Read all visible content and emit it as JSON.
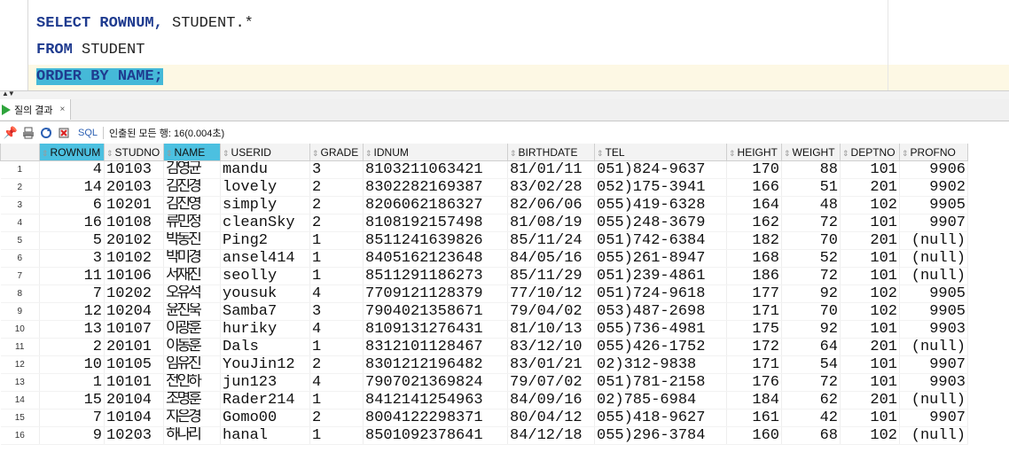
{
  "editor": {
    "line1": {
      "kw": "SELECT ROWNUM,",
      "rest": " STUDENT.*"
    },
    "line2": {
      "kw": "FROM",
      "rest": " STUDENT"
    },
    "line3": {
      "text": "ORDER BY NAME;"
    }
  },
  "results_tab": {
    "label": "질의 결과",
    "close": "×"
  },
  "toolbar": {
    "sql_label": "SQL",
    "status": "인출된 모든 행: 16(0.004초)"
  },
  "colors": {
    "selection": "#45b9d8",
    "keyword": "#1f3b8f",
    "tab_icon": "#2fa43c"
  },
  "grid": {
    "columns": [
      "ROWNUM",
      "STUDNO",
      "NAME",
      "USERID",
      "GRADE",
      "IDNUM",
      "BIRTHDATE",
      "TEL",
      "HEIGHT",
      "WEIGHT",
      "DEPTNO",
      "PROFNO"
    ],
    "rows": [
      [
        "1",
        "4",
        "10103",
        "김영균",
        "mandu",
        "3",
        "8103211063421",
        "81/01/11",
        "051)824-9637",
        "170",
        "88",
        "101",
        "9906"
      ],
      [
        "2",
        "14",
        "20103",
        "김진경",
        "lovely",
        "2",
        "8302282169387",
        "83/02/28",
        "052)175-3941",
        "166",
        "51",
        "201",
        "9902"
      ],
      [
        "3",
        "6",
        "10201",
        "김진영",
        "simply",
        "2",
        "8206062186327",
        "82/06/06",
        "055)419-6328",
        "164",
        "48",
        "102",
        "9905"
      ],
      [
        "4",
        "16",
        "10108",
        "류민정",
        "cleanSky",
        "2",
        "8108192157498",
        "81/08/19",
        "055)248-3679",
        "162",
        "72",
        "101",
        "9907"
      ],
      [
        "5",
        "5",
        "20102",
        "박동진",
        "Ping2",
        "1",
        "8511241639826",
        "85/11/24",
        "051)742-6384",
        "182",
        "70",
        "201",
        "(null)"
      ],
      [
        "6",
        "3",
        "10102",
        "박미경",
        "ansel414",
        "1",
        "8405162123648",
        "84/05/16",
        "055)261-8947",
        "168",
        "52",
        "101",
        "(null)"
      ],
      [
        "7",
        "11",
        "10106",
        "서재진",
        "seolly",
        "1",
        "8511291186273",
        "85/11/29",
        "051)239-4861",
        "186",
        "72",
        "101",
        "(null)"
      ],
      [
        "8",
        "7",
        "10202",
        "오유석",
        "yousuk",
        "4",
        "7709121128379",
        "77/10/12",
        "051)724-9618",
        "177",
        "92",
        "102",
        "9905"
      ],
      [
        "9",
        "12",
        "10204",
        "윤진욱",
        "Samba7",
        "3",
        "7904021358671",
        "79/04/02",
        "053)487-2698",
        "171",
        "70",
        "102",
        "9905"
      ],
      [
        "10",
        "13",
        "10107",
        "이광훈",
        "huriky",
        "4",
        "8109131276431",
        "81/10/13",
        "055)736-4981",
        "175",
        "92",
        "101",
        "9903"
      ],
      [
        "11",
        "2",
        "20101",
        "이동훈",
        "Dals",
        "1",
        "8312101128467",
        "83/12/10",
        "055)426-1752",
        "172",
        "64",
        "201",
        "(null)"
      ],
      [
        "12",
        "10",
        "10105",
        "임유진",
        "YouJin12",
        "2",
        "8301212196482",
        "83/01/21",
        "02)312-9838",
        "171",
        "54",
        "101",
        "9907"
      ],
      [
        "13",
        "1",
        "10101",
        "전인하",
        "jun123",
        "4",
        "7907021369824",
        "79/07/02",
        "051)781-2158",
        "176",
        "72",
        "101",
        "9903"
      ],
      [
        "14",
        "15",
        "20104",
        "조명훈",
        "Rader214",
        "1",
        "8412141254963",
        "84/09/16",
        "02)785-6984",
        "184",
        "62",
        "201",
        "(null)"
      ],
      [
        "15",
        "7",
        "10104",
        "지은경",
        "Gomo00",
        "2",
        "8004122298371",
        "80/04/12",
        "055)418-9627",
        "161",
        "42",
        "101",
        "9907"
      ],
      [
        "16",
        "9",
        "10203",
        "하나리",
        "hanal",
        "1",
        "8501092378641",
        "84/12/18",
        "055)296-3784",
        "160",
        "68",
        "102",
        "(null)"
      ]
    ]
  }
}
